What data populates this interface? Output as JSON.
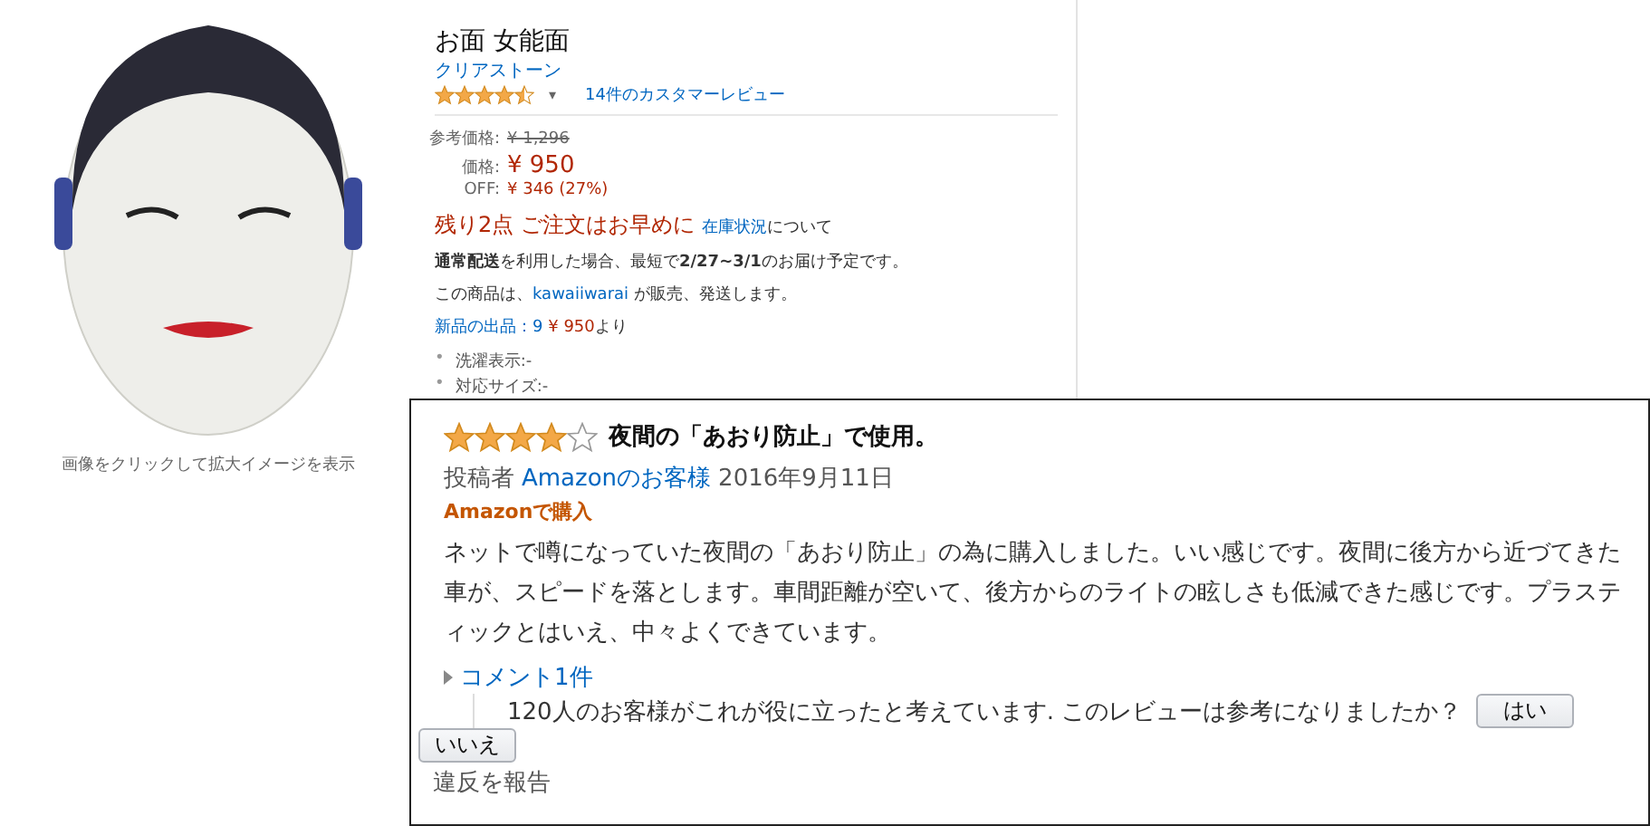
{
  "product": {
    "title": "お面 女能面",
    "brand": "クリアストーン",
    "stars": 4.5,
    "dropdown": "▾",
    "review_count": "14件のカスタマーレビュー",
    "prices": [
      {
        "label": "参考価格:",
        "value": "¥ 1,296",
        "kind": "list"
      },
      {
        "label": "価格:",
        "value": "¥ 950",
        "kind": "price"
      },
      {
        "label": "OFF:",
        "value": "¥ 346 (27%)",
        "kind": "savings"
      }
    ],
    "stock_notice": "残り2点 ご注文はお早めに",
    "stock_link": "在庫状況",
    "stock_suffix": "について",
    "shipping": "**通常配送**を利用した場合、最短で**2/27~3/1**のお届け予定です。",
    "seller_prefix": "この商品は、",
    "seller": "kawaiiwarai",
    "seller_suffix": " が販売、発送します。",
    "offers_link": "新品の出品：9",
    "offers_price": "¥ 950",
    "offers_suffix": "より",
    "bullets": [
      {
        "marker": "•",
        "text": "洗濯表示:-"
      },
      {
        "marker": "•",
        "text": "対応サイズ:-"
      }
    ]
  },
  "image_caption": "画像をクリックして拡大イメージを表示",
  "review": {
    "stars": 4,
    "title": "夜間の「あおり防止」で使用。",
    "author_prefix": "投稿者",
    "author": "Amazonのお客様",
    "date": "2016年9月11日",
    "badge": "Amazonで購入",
    "body": "ネットで噂になっていた夜間の「あおり防止」の為に購入しました。いい感じです。夜間に後方から近づてきた車が、スピードを落とします。車間距離が空いて、後方からのライトの眩しさも低減できた感じです。プラスティックとはいえ、中々よくできています。",
    "comments": "コメント1件",
    "helpful": "120人のお客様がこれが役に立ったと考えています. このレビューは参考になりましたか？",
    "buttons": [
      "はい",
      "いいえ"
    ],
    "report": "違反を報告"
  }
}
